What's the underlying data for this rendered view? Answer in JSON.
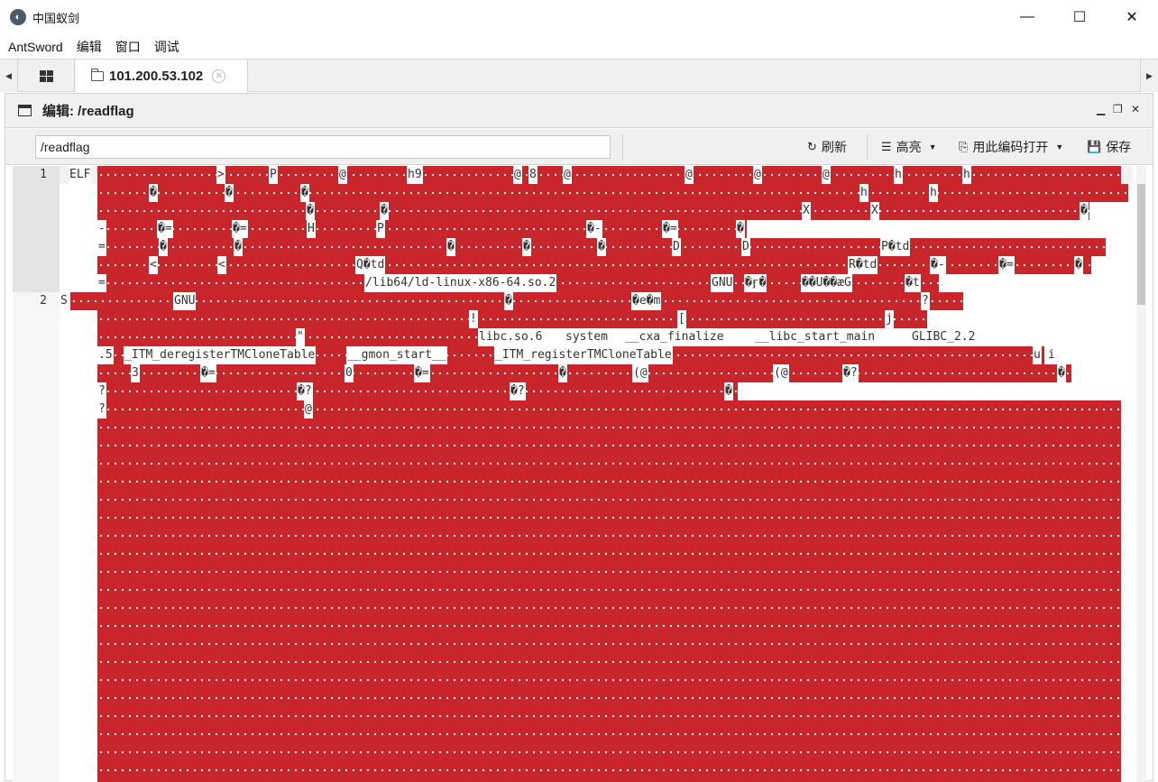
{
  "window": {
    "title": "中国蚁剑",
    "logo_glyph": "◐",
    "controls": [
      "—",
      "☐",
      "✕"
    ]
  },
  "menu": [
    "AntSword",
    "编辑",
    "窗口",
    "调试"
  ],
  "tabs": {
    "active_label": "101.200.53.102",
    "close_glyph": "✕"
  },
  "panel": {
    "title": "编辑: /readflag",
    "path_value": "/readflag",
    "refresh_label": "刷新",
    "highlight_label": "高亮",
    "open_with_encoding_label": "用此编码打开",
    "save_label": "保存"
  },
  "editor": {
    "line_numbers": [
      "1",
      "2"
    ],
    "colors": {
      "control_char_bg": "#c9262c",
      "text": "#333333"
    },
    "text_fragments": [
      "ELF",
      ">",
      "P",
      "@",
      "h9",
      "@",
      "8",
      "@",
      "@",
      "@",
      "@",
      "h",
      "h",
      "�",
      "�",
      "�",
      "h",
      "h",
      "�",
      "�",
      "X",
      "X",
      "�",
      "-",
      "�=",
      "�=",
      "H",
      "P",
      "�-",
      "�=",
      "�",
      "=",
      "�",
      "�",
      "�",
      "�",
      "�",
      "D",
      "D",
      "P�td",
      "<",
      "<",
      "Q�td",
      "R�td",
      "�-",
      "�=",
      "�",
      "=",
      "/lib64/ld-linux-x86-64.so.2",
      "GNU",
      "�ӻ�",
      "��U��æG",
      "�t",
      "S",
      "GNU",
      "�",
      "�e�m",
      "?",
      "!",
      "[",
      "j",
      "\"",
      "libc.so.6",
      "system",
      "__cxa_finalize",
      "__libc_start_main",
      "GLIBC_2.2",
      ".5",
      "_ITM_deregisterTMCloneTable",
      "__gmon_start__",
      "_ITM_registerTMCloneTable",
      "u",
      "i",
      "3",
      "�=",
      "0",
      "�=",
      "�",
      "(@",
      "(@",
      "�?",
      "�",
      "?",
      "�?",
      "�?",
      "�",
      "?",
      "@"
    ]
  }
}
